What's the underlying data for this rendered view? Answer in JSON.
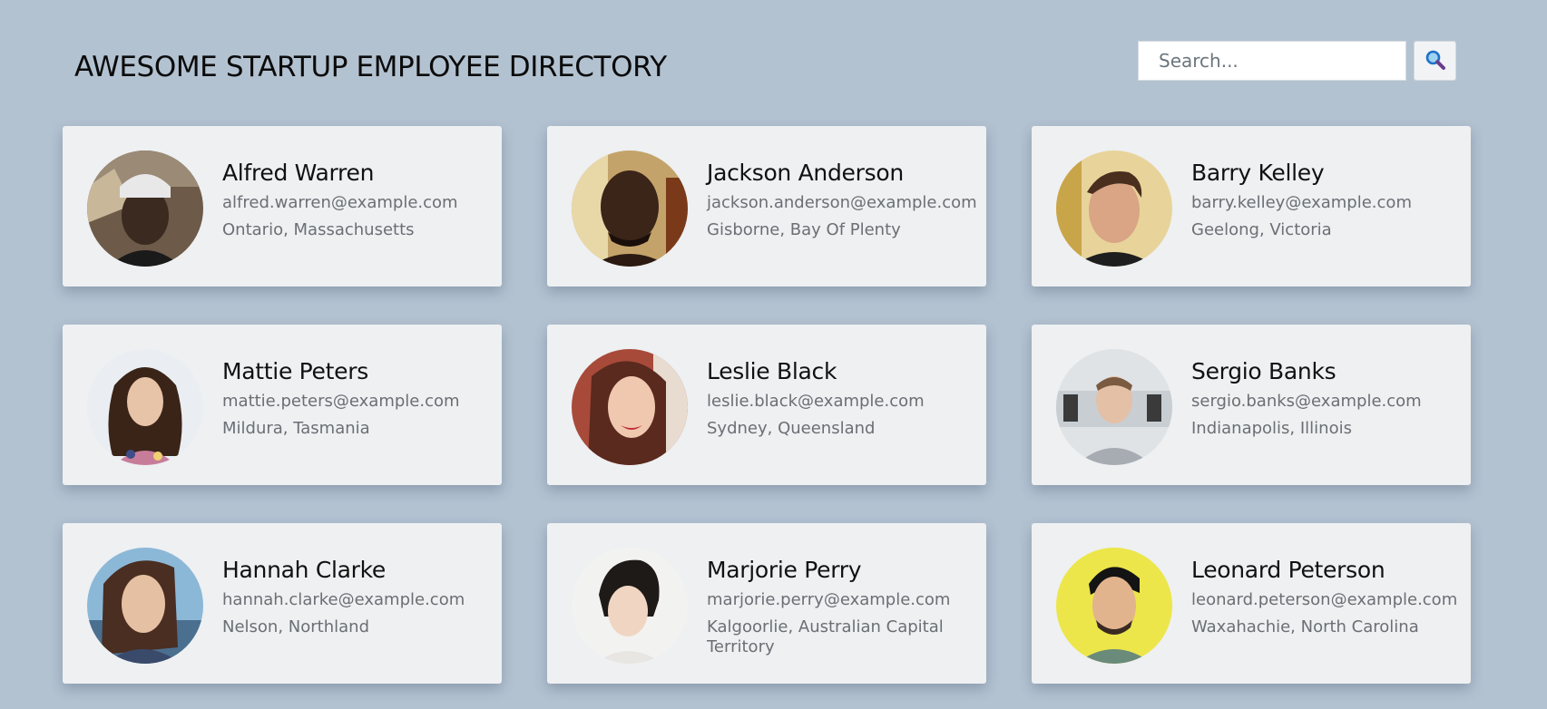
{
  "header": {
    "title": "AWESOME STARTUP EMPLOYEE DIRECTORY"
  },
  "search": {
    "placeholder": "Search...",
    "value": "",
    "button_icon": "magnifying-glass-icon"
  },
  "employees": [
    {
      "name": "Alfred Warren",
      "email": "alfred.warren@example.com",
      "location": "Ontario, Massachusetts"
    },
    {
      "name": "Jackson Anderson",
      "email": "jackson.anderson@example.com",
      "location": "Gisborne, Bay Of Plenty"
    },
    {
      "name": "Barry Kelley",
      "email": "barry.kelley@example.com",
      "location": "Geelong, Victoria"
    },
    {
      "name": "Mattie Peters",
      "email": "mattie.peters@example.com",
      "location": "Mildura, Tasmania"
    },
    {
      "name": "Leslie Black",
      "email": "leslie.black@example.com",
      "location": "Sydney, Queensland"
    },
    {
      "name": "Sergio Banks",
      "email": "sergio.banks@example.com",
      "location": "Indianapolis, Illinois"
    },
    {
      "name": "Hannah Clarke",
      "email": "hannah.clarke@example.com",
      "location": "Nelson, Northland"
    },
    {
      "name": "Marjorie Perry",
      "email": "marjorie.perry@example.com",
      "location": "Kalgoorlie, Australian Capital Territory"
    },
    {
      "name": "Leonard Peterson",
      "email": "leonard.peterson@example.com",
      "location": "Waxahachie, North Carolina"
    }
  ],
  "colors": {
    "background": "#b3c2d1",
    "card": "#eef0f2",
    "name_text": "#111111",
    "secondary_text": "#6b6f74"
  }
}
